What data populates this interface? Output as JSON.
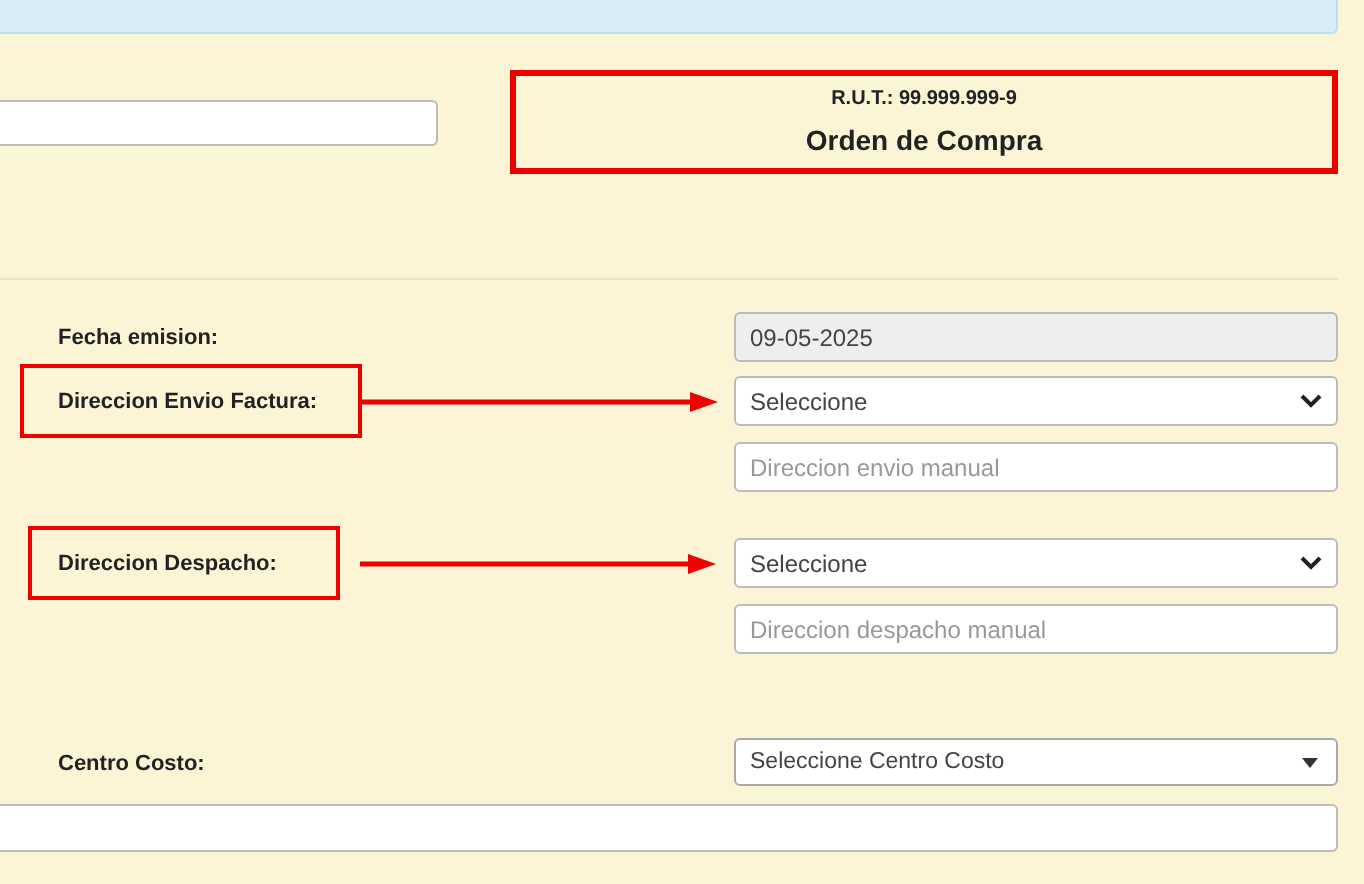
{
  "header": {
    "rut": "R.U.T.: 99.999.999-9",
    "title": "Orden de Compra",
    "highlighted": true
  },
  "form": [
    {
      "label": "Fecha emision:",
      "highlighted": false,
      "controls": [
        {
          "kind": "date",
          "value": "09-05-2025",
          "disabled": true
        }
      ]
    },
    {
      "label": "Direccion Envio Factura:",
      "highlighted": true,
      "controls": [
        {
          "kind": "select",
          "value": "Seleccione"
        },
        {
          "kind": "text",
          "placeholder": "Direccion envio manual"
        }
      ]
    },
    {
      "label": "Direccion Despacho:",
      "highlighted": true,
      "controls": [
        {
          "kind": "select",
          "value": "Seleccione"
        },
        {
          "kind": "text",
          "placeholder": "Direccion despacho manual"
        }
      ]
    },
    {
      "label": "Centro Costo:",
      "highlighted": false,
      "controls": [
        {
          "kind": "select2",
          "value": "Seleccione Centro Costo"
        }
      ]
    }
  ]
}
